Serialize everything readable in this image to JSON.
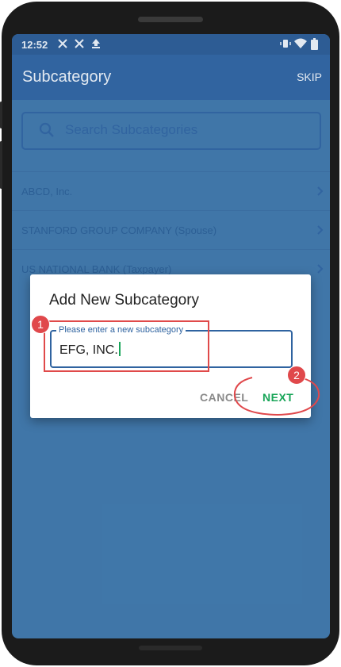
{
  "statusbar": {
    "time": "12:52"
  },
  "appbar": {
    "title": "Subcategory",
    "skip_label": "SKIP"
  },
  "search": {
    "placeholder": "Search Subcategories"
  },
  "list": {
    "items": [
      {
        "label": "ABCD, Inc."
      },
      {
        "label": "STANFORD GROUP COMPANY (Spouse)"
      },
      {
        "label": "US NATIONAL BANK (Taxpayer)"
      }
    ]
  },
  "dialog": {
    "title": "Add New Subcategory",
    "field_label": "Please enter a new subcategory",
    "field_value": "EFG, INC.",
    "cancel_label": "CANCEL",
    "next_label": "NEXT"
  },
  "callouts": {
    "step1": "1",
    "step2": "2"
  },
  "colors": {
    "appbar": "#2f63a0",
    "screen_bg": "#4178aa",
    "next": "#18a558",
    "callout": "#e0484b"
  }
}
